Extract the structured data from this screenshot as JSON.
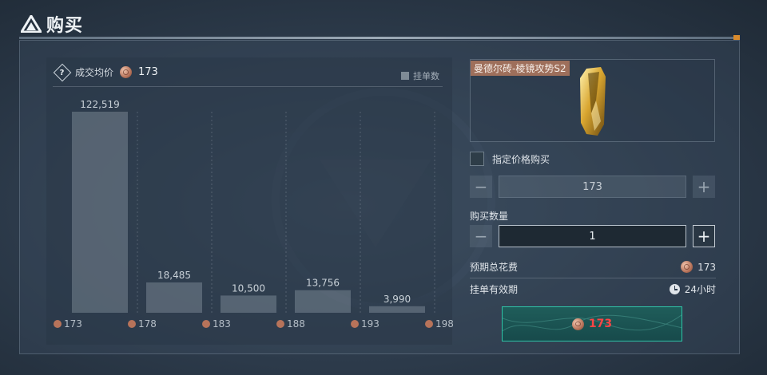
{
  "window": {
    "title": "购买"
  },
  "average": {
    "label": "成交均价",
    "value": "173"
  },
  "legend": {
    "label": "挂单数"
  },
  "chart_data": {
    "type": "bar",
    "categories": [
      "173",
      "178",
      "183",
      "188",
      "193",
      "198"
    ],
    "series": [
      {
        "name": "挂单数",
        "values": [
          122519,
          18485,
          10500,
          13756,
          3990,
          0
        ]
      }
    ],
    "value_labels": [
      "122,519",
      "18,485",
      "10,500",
      "13,756",
      "3,990",
      ""
    ],
    "x_axis_coin_icon": "copper-coin-icon",
    "ylim": [
      0,
      122519
    ],
    "grid": false
  },
  "item": {
    "name": "曼德尔砖-棱镜攻势S2"
  },
  "specified_price": {
    "label": "指定价格购买",
    "checked": false
  },
  "price_stepper": {
    "value": "173",
    "minus": "−",
    "plus": "+"
  },
  "quantity": {
    "label": "购买数量",
    "value": "1",
    "minus": "−",
    "plus": "+"
  },
  "estimated_cost": {
    "label": "预期总花费",
    "value": "173"
  },
  "validity": {
    "label": "挂单有效期",
    "value": "24小时"
  },
  "buy_button": {
    "price": "173"
  },
  "colors": {
    "accent": "#2fc4a8",
    "price_red": "#ff4545",
    "coin": "#b7735a",
    "item_tag": "#9e6f5b"
  }
}
